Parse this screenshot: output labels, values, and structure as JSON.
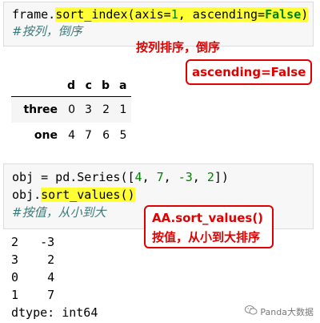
{
  "cell1": {
    "code_prefix": "frame.",
    "code_hl": "sort_index",
    "code_args_a": "(axis=",
    "code_num": "1",
    "code_args_b": ", ascending=",
    "code_kw": "False",
    "code_close": ")",
    "comment": "#按列，倒序"
  },
  "annot1": {
    "label": "按列排序，倒序",
    "box": "ascending=False"
  },
  "dataframe": {
    "columns": [
      "d",
      "c",
      "b",
      "a"
    ],
    "rows": [
      {
        "index": "three",
        "values": [
          "0",
          "3",
          "2",
          "1"
        ]
      },
      {
        "index": "one",
        "values": [
          "4",
          "7",
          "6",
          "5"
        ]
      }
    ]
  },
  "cell2": {
    "line1_a": "obj = pd.Series([",
    "n1": "4",
    "sep1": ", ",
    "n2": "7",
    "sep2": ", ",
    "n3": "-3",
    "sep3": ", ",
    "n4": "2",
    "line1_b": "])",
    "line2_prefix": "obj.",
    "line2_hl": "sort_values()",
    "comment": "#按值，从小到大"
  },
  "annot2": {
    "line1": "AA.sort_values()",
    "line2": "按值，从小到大排序"
  },
  "output": {
    "lines": [
      "2   -3",
      "3    2",
      "0    4",
      "1    7",
      "dtype: int64"
    ]
  },
  "watermark": {
    "text": "Panda大数据",
    "icon": "wechat-icon"
  },
  "colors": {
    "highlight": "#ffff33",
    "annotation": "#e00000"
  }
}
